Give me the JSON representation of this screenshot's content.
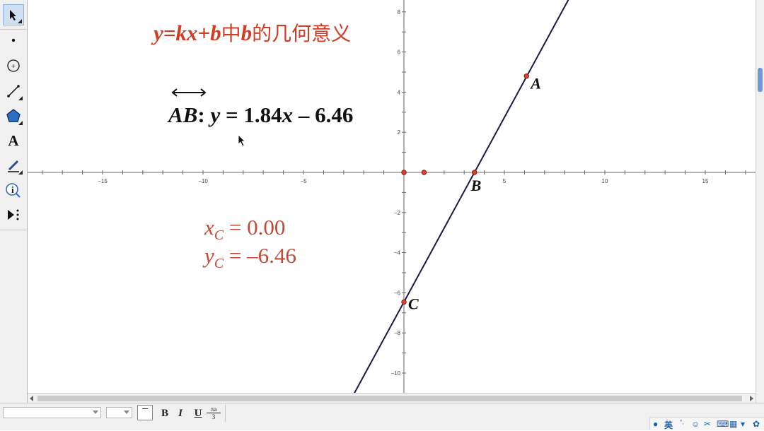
{
  "toolbar": {
    "tools": [
      {
        "name": "select-arrow-tool",
        "icon": "arrow-pointer-icon"
      },
      {
        "name": "point-tool",
        "icon": "point-icon"
      },
      {
        "name": "compass-tool",
        "icon": "circle-icon"
      },
      {
        "name": "straightedge-tool",
        "icon": "line-segment-icon"
      },
      {
        "name": "polygon-tool",
        "icon": "pentagon-icon"
      },
      {
        "name": "text-tool",
        "icon": "text-a-icon",
        "label": "A"
      },
      {
        "name": "marker-tool",
        "icon": "pen-icon"
      },
      {
        "name": "information-tool",
        "icon": "info-icon",
        "label": "i"
      },
      {
        "name": "custom-tool",
        "icon": "play-more-icon"
      }
    ]
  },
  "canvas": {
    "title": {
      "part1": "y=kx+b",
      "part2": "中",
      "part3": "b",
      "part4": "的几何意义"
    },
    "equation": {
      "line": "AB",
      "colon": ":",
      "y": "y",
      "equals": " = 1.84",
      "x": "x",
      "rest": " – 6.46"
    },
    "measure_x": {
      "var": "x",
      "sub": "C",
      "value": " = 0.00"
    },
    "measure_y": {
      "var": "y",
      "sub": "C",
      "value": " = –6.46"
    },
    "colors": {
      "title": "#d23c22",
      "measurement": "#c24a36",
      "line": "#1a1a4a",
      "point_fill": "#e0412c"
    }
  },
  "chart_data": {
    "type": "line",
    "title": "",
    "xlabel": "",
    "ylabel": "",
    "xlim": [
      -18,
      17.5
    ],
    "ylim": [
      -11,
      8.5
    ],
    "x_ticks": [
      -15,
      -10,
      -5,
      5,
      10,
      15
    ],
    "y_ticks": [
      8,
      6,
      4,
      2,
      -2,
      -4,
      -6,
      -8,
      -10
    ],
    "grid": false,
    "line": {
      "slope": 1.84,
      "intercept": -6.46
    },
    "points": [
      {
        "label": "A",
        "x": 6.1,
        "y": 4.8
      },
      {
        "label": "B",
        "x": 3.51,
        "y": 0
      },
      {
        "label": "C",
        "x": 0,
        "y": -6.46
      },
      {
        "label": "",
        "x": 0,
        "y": 0
      },
      {
        "label": "",
        "x": 1,
        "y": 0
      }
    ]
  },
  "formatbar": {
    "font_value": "",
    "size_value": "",
    "bold": "B",
    "italic": "I",
    "underline": "U",
    "math_top": "πa",
    "math_bottom": "3"
  },
  "tray": {
    "ime": "英",
    "icons": [
      "user-icon",
      "moon-icon",
      "smile-icon",
      "scissors-icon",
      "keyboard-icon",
      "apps-icon",
      "shirt-icon",
      "gear-icon"
    ]
  }
}
